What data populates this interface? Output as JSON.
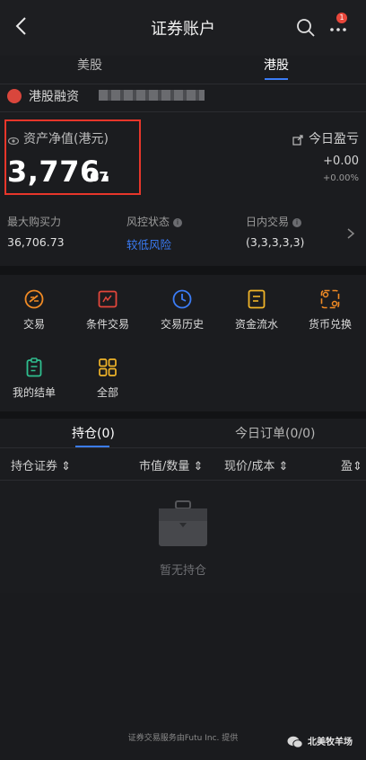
{
  "header": {
    "title": "证券账户",
    "badge": "1"
  },
  "market_tabs": {
    "us": "美股",
    "hk": "港股"
  },
  "account": {
    "label": "港股融资"
  },
  "asset": {
    "label": "资产净值(港元)",
    "value_main": "3,776.",
    "value_decimal": "67",
    "pnl_label": "今日盈亏",
    "pnl_value": "+0.00",
    "pnl_pct": "+0.00%"
  },
  "stats": [
    {
      "label": "最大购买力",
      "value": "36,706.73",
      "color": "#e0e0e0"
    },
    {
      "label": "风控状态",
      "value": "较低风险",
      "color": "#3b7cf6"
    },
    {
      "label": "日内交易",
      "value": "(3,3,3,3,3)",
      "color": "#e0e0e0"
    }
  ],
  "functions": [
    {
      "label": "交易",
      "icon": "trade-icon",
      "color": "#f08a24"
    },
    {
      "label": "条件交易",
      "icon": "condition-trade-icon",
      "color": "#e2463b"
    },
    {
      "label": "交易历史",
      "icon": "clock-icon",
      "color": "#3b7cf6"
    },
    {
      "label": "资金流水",
      "icon": "document-icon",
      "color": "#f0b429"
    },
    {
      "label": "货币兑换",
      "icon": "exchange-icon",
      "color": "#f08a24"
    },
    {
      "label": "我的结单",
      "icon": "clipboard-icon",
      "color": "#2fbf8f"
    },
    {
      "label": "全部",
      "icon": "grid-icon",
      "color": "#f0b429"
    }
  ],
  "position_tabs": {
    "holdings": "持仓(0)",
    "orders": "今日订单(0/0)"
  },
  "columns": [
    "持仓证券 ⇕",
    "市值/数量 ⇕",
    "现价/成本 ⇕",
    "盈⇕"
  ],
  "empty_text": "暂无持仓",
  "footer": "证券交易服务由Futu Inc. 提供",
  "watermark": "北美牧羊场"
}
